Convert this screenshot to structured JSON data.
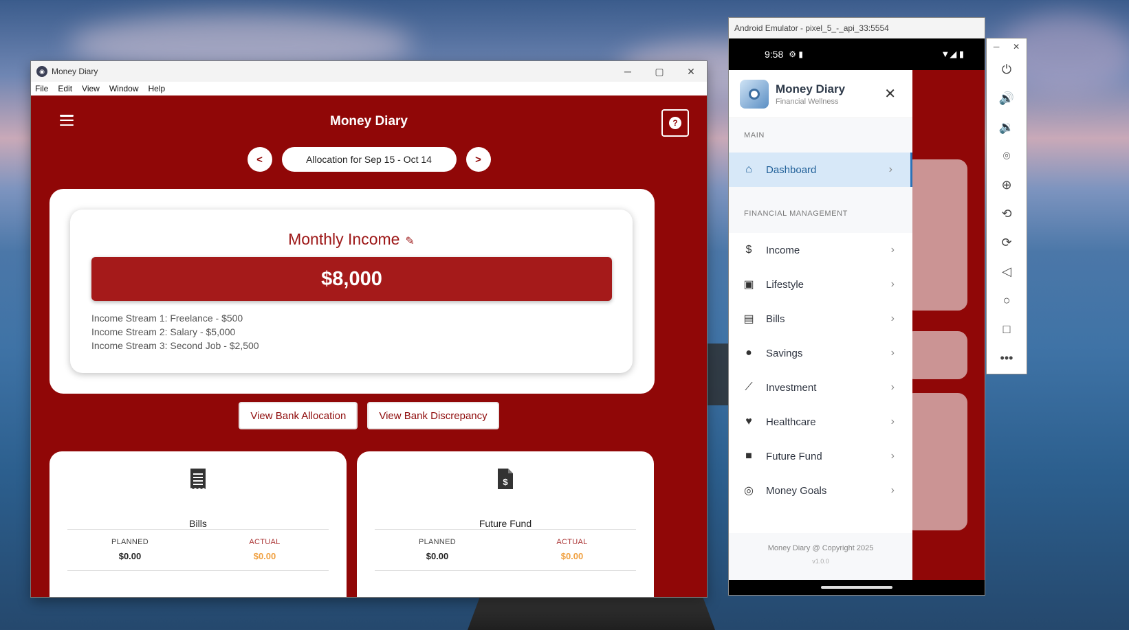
{
  "desktop_app": {
    "window_title": "Money Diary",
    "menu": [
      "File",
      "Edit",
      "View",
      "Window",
      "Help"
    ],
    "header_title": "Money Diary",
    "help_icon": "?",
    "period": {
      "prev": "<",
      "label": "Allocation for Sep 15 - Oct 14",
      "next": ">"
    },
    "income": {
      "title": "Monthly Income",
      "amount": "$8,000",
      "streams": [
        "Income Stream 1: Freelance - $500",
        "Income Stream 2: Salary - $5,000",
        "Income Stream 3: Second Job - $2,500"
      ]
    },
    "buttons": {
      "bank_allocation": "View Bank Allocation",
      "bank_discrepancy": "View Bank Discrepancy"
    },
    "categories": [
      {
        "name": "Bills",
        "icon": "receipt-icon",
        "planned_label": "PLANNED",
        "planned": "$0.00",
        "actual_label": "ACTUAL",
        "actual": "$0.00"
      },
      {
        "name": "Future Fund",
        "icon": "invoice-dollar-icon",
        "planned_label": "PLANNED",
        "planned": "$0.00",
        "actual_label": "ACTUAL",
        "actual": "$0.00"
      }
    ],
    "accent": "#900707"
  },
  "emulator": {
    "title": "Android Emulator - pixel_5_-_api_33:5554",
    "time": "9:58",
    "drawer": {
      "app_name": "Money Diary",
      "subtitle": "Financial Wellness",
      "section_main": "MAIN",
      "section_fin": "FINANCIAL MANAGEMENT",
      "items": [
        {
          "label": "Dashboard",
          "icon": "home-icon"
        },
        {
          "label": "Income",
          "icon": "dollar-icon"
        },
        {
          "label": "Lifestyle",
          "icon": "money-bill-icon"
        },
        {
          "label": "Bills",
          "icon": "file-icon"
        },
        {
          "label": "Savings",
          "icon": "piggy-bank-icon"
        },
        {
          "label": "Investment",
          "icon": "chart-line-icon"
        },
        {
          "label": "Healthcare",
          "icon": "heartbeat-icon"
        },
        {
          "label": "Future Fund",
          "icon": "briefcase-icon"
        },
        {
          "label": "Money Goals",
          "icon": "target-icon"
        }
      ],
      "footer": "Money Diary @ Copyright 2025",
      "version": "v1.0.0"
    }
  }
}
